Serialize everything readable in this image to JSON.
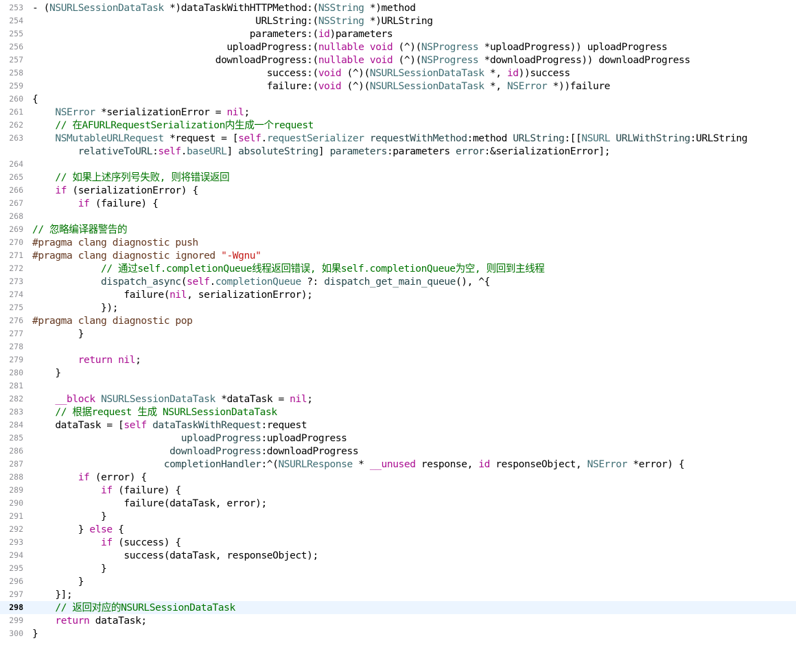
{
  "editor": {
    "current_line": "298",
    "colors": {
      "keyword": "#aa0d91",
      "class_name": "#3f6e74",
      "property": "#3f6e74",
      "function": "#26474b",
      "string": "#c41a16",
      "comment": "#007400",
      "preprocessor": "#643820",
      "plain": "#000000",
      "current_line_highlight": "#ecf5ff",
      "line_number": "#8e8e93"
    },
    "lines": [
      {
        "n": "253",
        "tokens": [
          [
            "pl",
            "- ("
          ],
          [
            "cls",
            "NSURLSessionDataTask"
          ],
          [
            "pl",
            " *)dataTaskWithHTTPMethod:("
          ],
          [
            "cls",
            "NSString"
          ],
          [
            "pl",
            " *)method"
          ]
        ]
      },
      {
        "n": "254",
        "tokens": [
          [
            "pl",
            "                                       URLString:("
          ],
          [
            "cls",
            "NSString"
          ],
          [
            "pl",
            " *)URLString"
          ]
        ]
      },
      {
        "n": "255",
        "tokens": [
          [
            "pl",
            "                                      parameters:("
          ],
          [
            "kw",
            "id"
          ],
          [
            "pl",
            ")parameters"
          ]
        ]
      },
      {
        "n": "256",
        "tokens": [
          [
            "pl",
            "                                  uploadProgress:("
          ],
          [
            "kw",
            "nullable"
          ],
          [
            "pl",
            " "
          ],
          [
            "kw",
            "void"
          ],
          [
            "pl",
            " (^)("
          ],
          [
            "cls",
            "NSProgress"
          ],
          [
            "pl",
            " *uploadProgress)) uploadProgress"
          ]
        ]
      },
      {
        "n": "257",
        "tokens": [
          [
            "pl",
            "                                downloadProgress:("
          ],
          [
            "kw",
            "nullable"
          ],
          [
            "pl",
            " "
          ],
          [
            "kw",
            "void"
          ],
          [
            "pl",
            " (^)("
          ],
          [
            "cls",
            "NSProgress"
          ],
          [
            "pl",
            " *downloadProgress)) downloadProgress"
          ]
        ]
      },
      {
        "n": "258",
        "tokens": [
          [
            "pl",
            "                                         success:("
          ],
          [
            "kw",
            "void"
          ],
          [
            "pl",
            " (^)("
          ],
          [
            "cls",
            "NSURLSessionDataTask"
          ],
          [
            "pl",
            " *, "
          ],
          [
            "kw",
            "id"
          ],
          [
            "pl",
            "))success"
          ]
        ]
      },
      {
        "n": "259",
        "tokens": [
          [
            "pl",
            "                                         failure:("
          ],
          [
            "kw",
            "void"
          ],
          [
            "pl",
            " (^)("
          ],
          [
            "cls",
            "NSURLSessionDataTask"
          ],
          [
            "pl",
            " *, "
          ],
          [
            "cls",
            "NSError"
          ],
          [
            "pl",
            " *))failure"
          ]
        ]
      },
      {
        "n": "260",
        "tokens": [
          [
            "pl",
            "{"
          ]
        ]
      },
      {
        "n": "261",
        "tokens": [
          [
            "pl",
            "    "
          ],
          [
            "cls",
            "NSError"
          ],
          [
            "pl",
            " *serializationError = "
          ],
          [
            "kw",
            "nil"
          ],
          [
            "pl",
            ";"
          ]
        ]
      },
      {
        "n": "262",
        "tokens": [
          [
            "pl",
            "    "
          ],
          [
            "com",
            "// 在AFURLRequestSerialization内生成一个request"
          ]
        ]
      },
      {
        "n": "263",
        "tall": true,
        "tokens": [
          [
            "pl",
            "    "
          ],
          [
            "cls",
            "NSMutableURLRequest"
          ],
          [
            "pl",
            " *request = ["
          ],
          [
            "kw",
            "self"
          ],
          [
            "pl",
            "."
          ],
          [
            "prop",
            "requestSerializer"
          ],
          [
            "pl",
            " "
          ],
          [
            "fn",
            "requestWithMethod"
          ],
          [
            "pl",
            ":method "
          ],
          [
            "fn",
            "URLString"
          ],
          [
            "pl",
            ":[["
          ],
          [
            "cls",
            "NSURL"
          ],
          [
            "pl",
            " "
          ],
          [
            "fn",
            "URLWithString"
          ],
          [
            "pl",
            ":URLString\n        "
          ],
          [
            "fn",
            "relativeToURL"
          ],
          [
            "pl",
            ":"
          ],
          [
            "kw",
            "self"
          ],
          [
            "pl",
            "."
          ],
          [
            "prop",
            "baseURL"
          ],
          [
            "pl",
            "] "
          ],
          [
            "fn",
            "absoluteString"
          ],
          [
            "pl",
            "] "
          ],
          [
            "fn",
            "parameters"
          ],
          [
            "pl",
            ":parameters "
          ],
          [
            "fn",
            "error"
          ],
          [
            "pl",
            ":&serializationError];"
          ]
        ]
      },
      {
        "n": "264",
        "tokens": []
      },
      {
        "n": "265",
        "tokens": [
          [
            "pl",
            "    "
          ],
          [
            "com",
            "// 如果上述序列号失败, 则将错误返回"
          ]
        ]
      },
      {
        "n": "266",
        "tokens": [
          [
            "pl",
            "    "
          ],
          [
            "kw",
            "if"
          ],
          [
            "pl",
            " (serializationError) {"
          ]
        ]
      },
      {
        "n": "267",
        "tokens": [
          [
            "pl",
            "        "
          ],
          [
            "kw",
            "if"
          ],
          [
            "pl",
            " (failure) {"
          ]
        ]
      },
      {
        "n": "268",
        "tokens": []
      },
      {
        "n": "269",
        "tokens": [
          [
            "com",
            "// 忽略编译器警告的"
          ]
        ]
      },
      {
        "n": "270",
        "tokens": [
          [
            "pp",
            "#pragma clang diagnostic push"
          ]
        ]
      },
      {
        "n": "271",
        "tokens": [
          [
            "pp",
            "#pragma clang diagnostic ignored "
          ],
          [
            "str",
            "\"-Wgnu\""
          ]
        ]
      },
      {
        "n": "272",
        "tokens": [
          [
            "pl",
            "            "
          ],
          [
            "com",
            "// 通过self.completionQueue线程返回错误, 如果self.completionQueue为空, 则回到主线程"
          ]
        ]
      },
      {
        "n": "273",
        "tokens": [
          [
            "pl",
            "            "
          ],
          [
            "fn",
            "dispatch_async"
          ],
          [
            "pl",
            "("
          ],
          [
            "kw",
            "self"
          ],
          [
            "pl",
            "."
          ],
          [
            "prop",
            "completionQueue"
          ],
          [
            "pl",
            " ?: "
          ],
          [
            "fn",
            "dispatch_get_main_queue"
          ],
          [
            "pl",
            "(), ^{"
          ]
        ]
      },
      {
        "n": "274",
        "tokens": [
          [
            "pl",
            "                failure("
          ],
          [
            "kw",
            "nil"
          ],
          [
            "pl",
            ", serializationError);"
          ]
        ]
      },
      {
        "n": "275",
        "tokens": [
          [
            "pl",
            "            });"
          ]
        ]
      },
      {
        "n": "276",
        "tokens": [
          [
            "pp",
            "#pragma clang diagnostic pop"
          ]
        ]
      },
      {
        "n": "277",
        "tokens": [
          [
            "pl",
            "        }"
          ]
        ]
      },
      {
        "n": "278",
        "tokens": []
      },
      {
        "n": "279",
        "tokens": [
          [
            "pl",
            "        "
          ],
          [
            "kw",
            "return"
          ],
          [
            "pl",
            " "
          ],
          [
            "kw",
            "nil"
          ],
          [
            "pl",
            ";"
          ]
        ]
      },
      {
        "n": "280",
        "tokens": [
          [
            "pl",
            "    }"
          ]
        ]
      },
      {
        "n": "281",
        "tokens": []
      },
      {
        "n": "282",
        "tokens": [
          [
            "pl",
            "    "
          ],
          [
            "kw",
            "__block"
          ],
          [
            "pl",
            " "
          ],
          [
            "cls",
            "NSURLSessionDataTask"
          ],
          [
            "pl",
            " *dataTask = "
          ],
          [
            "kw",
            "nil"
          ],
          [
            "pl",
            ";"
          ]
        ]
      },
      {
        "n": "283",
        "tokens": [
          [
            "pl",
            "    "
          ],
          [
            "com",
            "// 根据request 生成 NSURLSessionDataTask"
          ]
        ]
      },
      {
        "n": "284",
        "tokens": [
          [
            "pl",
            "    dataTask = ["
          ],
          [
            "kw",
            "self"
          ],
          [
            "pl",
            " "
          ],
          [
            "fn",
            "dataTaskWithRequest"
          ],
          [
            "pl",
            ":request"
          ]
        ]
      },
      {
        "n": "285",
        "tokens": [
          [
            "pl",
            "                          "
          ],
          [
            "fn",
            "uploadProgress"
          ],
          [
            "pl",
            ":uploadProgress"
          ]
        ]
      },
      {
        "n": "286",
        "tokens": [
          [
            "pl",
            "                        "
          ],
          [
            "fn",
            "downloadProgress"
          ],
          [
            "pl",
            ":downloadProgress"
          ]
        ]
      },
      {
        "n": "287",
        "tokens": [
          [
            "pl",
            "                       "
          ],
          [
            "fn",
            "completionHandler"
          ],
          [
            "pl",
            ":^("
          ],
          [
            "cls",
            "NSURLResponse"
          ],
          [
            "pl",
            " * "
          ],
          [
            "kw",
            "__unused"
          ],
          [
            "pl",
            " response, "
          ],
          [
            "kw",
            "id"
          ],
          [
            "pl",
            " responseObject, "
          ],
          [
            "cls",
            "NSError"
          ],
          [
            "pl",
            " *error) {"
          ]
        ]
      },
      {
        "n": "288",
        "tokens": [
          [
            "pl",
            "        "
          ],
          [
            "kw",
            "if"
          ],
          [
            "pl",
            " (error) {"
          ]
        ]
      },
      {
        "n": "289",
        "tokens": [
          [
            "pl",
            "            "
          ],
          [
            "kw",
            "if"
          ],
          [
            "pl",
            " (failure) {"
          ]
        ]
      },
      {
        "n": "290",
        "tokens": [
          [
            "pl",
            "                failure(dataTask, error);"
          ]
        ]
      },
      {
        "n": "291",
        "tokens": [
          [
            "pl",
            "            }"
          ]
        ]
      },
      {
        "n": "292",
        "tokens": [
          [
            "pl",
            "        } "
          ],
          [
            "kw",
            "else"
          ],
          [
            "pl",
            " {"
          ]
        ]
      },
      {
        "n": "293",
        "tokens": [
          [
            "pl",
            "            "
          ],
          [
            "kw",
            "if"
          ],
          [
            "pl",
            " (success) {"
          ]
        ]
      },
      {
        "n": "294",
        "tokens": [
          [
            "pl",
            "                success(dataTask, responseObject);"
          ]
        ]
      },
      {
        "n": "295",
        "tokens": [
          [
            "pl",
            "            }"
          ]
        ]
      },
      {
        "n": "296",
        "tokens": [
          [
            "pl",
            "        }"
          ]
        ]
      },
      {
        "n": "297",
        "tokens": [
          [
            "pl",
            "    }];"
          ]
        ]
      },
      {
        "n": "298",
        "tokens": [
          [
            "pl",
            "    "
          ],
          [
            "com",
            "// 返回对应的NSURLSessionDataTask"
          ]
        ]
      },
      {
        "n": "299",
        "tokens": [
          [
            "pl",
            "    "
          ],
          [
            "kw",
            "return"
          ],
          [
            "pl",
            " dataTask;"
          ]
        ]
      },
      {
        "n": "300",
        "tokens": [
          [
            "pl",
            "}"
          ]
        ]
      }
    ]
  }
}
